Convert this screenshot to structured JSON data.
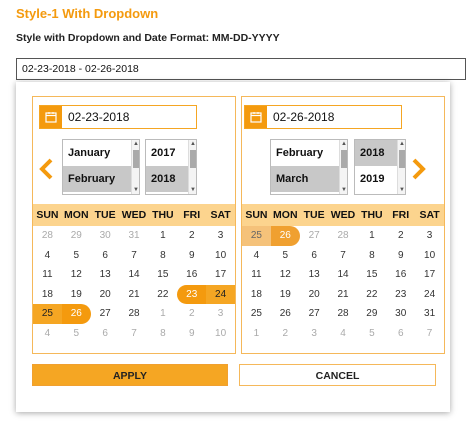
{
  "header": {
    "title": "Style-1 With Dropdown",
    "subtitle": "Style with Dropdown and Date Format: MM-DD-YYYY"
  },
  "range_input": {
    "value": "02-23-2018 - 02-26-2018"
  },
  "left": {
    "date": "02-23-2018",
    "months": [
      "January",
      "February"
    ],
    "selected_month": "February",
    "years": [
      "2017",
      "2018"
    ],
    "selected_year": "2018"
  },
  "right": {
    "date": "02-26-2018",
    "months": [
      "February",
      "March"
    ],
    "selected_month": "March",
    "years": [
      "2018",
      "2019"
    ],
    "selected_year": "2018"
  },
  "weekdays": [
    "SUN",
    "MON",
    "TUE",
    "WED",
    "THU",
    "FRI",
    "SAT"
  ],
  "left_weeks": [
    [
      {
        "d": "28",
        "s": "off"
      },
      {
        "d": "29",
        "s": "off"
      },
      {
        "d": "30",
        "s": "off"
      },
      {
        "d": "31",
        "s": "off"
      },
      {
        "d": "1",
        "s": ""
      },
      {
        "d": "2",
        "s": ""
      },
      {
        "d": "3",
        "s": ""
      }
    ],
    [
      {
        "d": "4",
        "s": ""
      },
      {
        "d": "5",
        "s": ""
      },
      {
        "d": "6",
        "s": ""
      },
      {
        "d": "7",
        "s": ""
      },
      {
        "d": "8",
        "s": ""
      },
      {
        "d": "9",
        "s": ""
      },
      {
        "d": "10",
        "s": ""
      }
    ],
    [
      {
        "d": "11",
        "s": ""
      },
      {
        "d": "12",
        "s": ""
      },
      {
        "d": "13",
        "s": ""
      },
      {
        "d": "14",
        "s": ""
      },
      {
        "d": "15",
        "s": ""
      },
      {
        "d": "16",
        "s": ""
      },
      {
        "d": "17",
        "s": ""
      }
    ],
    [
      {
        "d": "18",
        "s": ""
      },
      {
        "d": "19",
        "s": ""
      },
      {
        "d": "20",
        "s": ""
      },
      {
        "d": "21",
        "s": ""
      },
      {
        "d": "22",
        "s": ""
      },
      {
        "d": "23",
        "s": "start"
      },
      {
        "d": "24",
        "s": "range"
      }
    ],
    [
      {
        "d": "25",
        "s": "range"
      },
      {
        "d": "26",
        "s": "end"
      },
      {
        "d": "27",
        "s": ""
      },
      {
        "d": "28",
        "s": ""
      },
      {
        "d": "1",
        "s": "off"
      },
      {
        "d": "2",
        "s": "off"
      },
      {
        "d": "3",
        "s": "off"
      }
    ],
    [
      {
        "d": "4",
        "s": "off"
      },
      {
        "d": "5",
        "s": "off"
      },
      {
        "d": "6",
        "s": "off"
      },
      {
        "d": "7",
        "s": "off"
      },
      {
        "d": "8",
        "s": "off"
      },
      {
        "d": "9",
        "s": "off"
      },
      {
        "d": "10",
        "s": "off"
      }
    ]
  ],
  "right_weeks": [
    [
      {
        "d": "25",
        "s": "pale"
      },
      {
        "d": "26",
        "s": "pale-end"
      },
      {
        "d": "27",
        "s": "off"
      },
      {
        "d": "28",
        "s": "off"
      },
      {
        "d": "1",
        "s": ""
      },
      {
        "d": "2",
        "s": ""
      },
      {
        "d": "3",
        "s": ""
      }
    ],
    [
      {
        "d": "4",
        "s": ""
      },
      {
        "d": "5",
        "s": ""
      },
      {
        "d": "6",
        "s": ""
      },
      {
        "d": "7",
        "s": ""
      },
      {
        "d": "8",
        "s": ""
      },
      {
        "d": "9",
        "s": ""
      },
      {
        "d": "10",
        "s": ""
      }
    ],
    [
      {
        "d": "11",
        "s": ""
      },
      {
        "d": "12",
        "s": ""
      },
      {
        "d": "13",
        "s": ""
      },
      {
        "d": "14",
        "s": ""
      },
      {
        "d": "15",
        "s": ""
      },
      {
        "d": "16",
        "s": ""
      },
      {
        "d": "17",
        "s": ""
      }
    ],
    [
      {
        "d": "18",
        "s": ""
      },
      {
        "d": "19",
        "s": ""
      },
      {
        "d": "20",
        "s": ""
      },
      {
        "d": "21",
        "s": ""
      },
      {
        "d": "22",
        "s": ""
      },
      {
        "d": "23",
        "s": ""
      },
      {
        "d": "24",
        "s": ""
      }
    ],
    [
      {
        "d": "25",
        "s": ""
      },
      {
        "d": "26",
        "s": ""
      },
      {
        "d": "27",
        "s": ""
      },
      {
        "d": "28",
        "s": ""
      },
      {
        "d": "29",
        "s": ""
      },
      {
        "d": "30",
        "s": ""
      },
      {
        "d": "31",
        "s": ""
      }
    ],
    [
      {
        "d": "1",
        "s": "off"
      },
      {
        "d": "2",
        "s": "off"
      },
      {
        "d": "3",
        "s": "off"
      },
      {
        "d": "4",
        "s": "off"
      },
      {
        "d": "5",
        "s": "off"
      },
      {
        "d": "6",
        "s": "off"
      },
      {
        "d": "7",
        "s": "off"
      }
    ]
  ],
  "buttons": {
    "apply": "APPLY",
    "cancel": "CANCEL"
  },
  "colors": {
    "accent": "#f49a0e",
    "header_row": "#fcd48e",
    "range": "#f5a623"
  },
  "icons": {
    "date_box": "calendar-icon",
    "prev": "chevron-left-icon",
    "next": "chevron-right-icon"
  }
}
